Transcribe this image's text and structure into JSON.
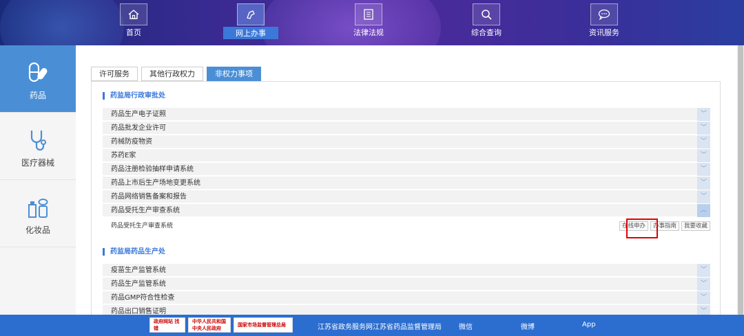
{
  "header": {
    "nav": [
      {
        "label": "首页",
        "icon": "home-icon"
      },
      {
        "label": "网上办事",
        "icon": "hand-icon",
        "active": true
      },
      {
        "label": "法律法规",
        "icon": "document-icon"
      },
      {
        "label": "综合查询",
        "icon": "search-icon"
      },
      {
        "label": "资讯服务",
        "icon": "chat-icon"
      }
    ]
  },
  "sidebar": {
    "items": [
      {
        "label": "药品",
        "icon": "pill-icon",
        "active": true
      },
      {
        "label": "医疗器械",
        "icon": "stethoscope-icon"
      },
      {
        "label": "化妆品",
        "icon": "cosmetics-icon"
      }
    ]
  },
  "tabs": [
    {
      "label": "许可服务"
    },
    {
      "label": "其他行政权力"
    },
    {
      "label": "非权力事项",
      "active": true
    }
  ],
  "sections": [
    {
      "title": "药监局行政审批处",
      "rows": [
        {
          "label": "药品生产电子证照"
        },
        {
          "label": "药品批发企业许可"
        },
        {
          "label": "药械防疫物资"
        },
        {
          "label": "苏药E家"
        },
        {
          "label": "药品注册检验抽样申请系统"
        },
        {
          "label": "药品上市后生产场地变更系统"
        },
        {
          "label": "药品网络销售备案和报告"
        },
        {
          "label": "药品受托生产审查系统",
          "expanded": true
        }
      ],
      "subrow": {
        "label": "药品受托生产审查系统",
        "actions": [
          "在线申办",
          "办事指南",
          "我要收藏"
        ]
      }
    },
    {
      "title": "药监局药品生产处",
      "rows": [
        {
          "label": "疫苗生产监管系统"
        },
        {
          "label": "药品生产监管系统"
        },
        {
          "label": "药品GMP符合性检查"
        },
        {
          "label": "药品出口销售证明"
        }
      ]
    }
  ],
  "footer": {
    "badges": [
      "政府网站 找错",
      "中华人民共和国 中央人民政府",
      "国家市场监督管理总局"
    ],
    "links": [
      "江苏省政务服务网",
      "江苏省药品监督管理局",
      "微信",
      "微博",
      "App"
    ]
  },
  "colors": {
    "accent": "#4a8fd6",
    "footer": "#2c6ed0",
    "highlight": "#e00000"
  }
}
